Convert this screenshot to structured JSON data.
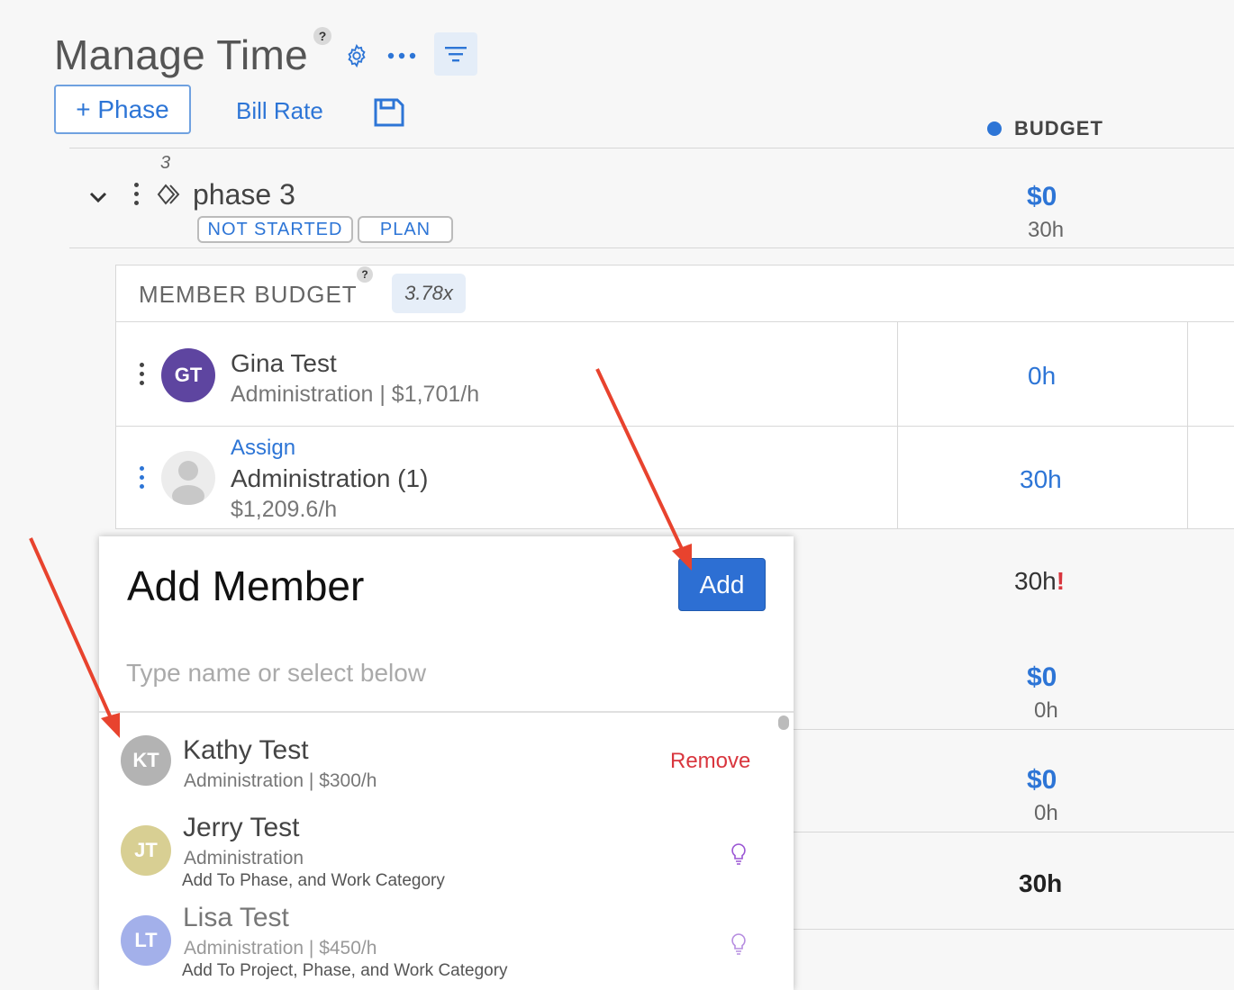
{
  "header": {
    "title": "Manage Time",
    "help": "?",
    "phase_button": "+ Phase",
    "bill_rate": "Bill Rate",
    "budget_label": "BUDGET"
  },
  "phase": {
    "number": "3",
    "name": "phase 3",
    "status": "NOT STARTED",
    "type": "PLAN",
    "budget_amount": "$0",
    "budget_hours": "30h"
  },
  "member_budget": {
    "title": "MEMBER BUDGET",
    "help": "?",
    "multiplier": "3.78x",
    "rows": [
      {
        "initials": "GT",
        "name": "Gina Test",
        "role": "Administration",
        "rate": "$1,701/h",
        "hours": "0h"
      },
      {
        "assign_label": "Assign",
        "name": "Administration (1)",
        "rate": "$1,209.6/h",
        "hours": "30h"
      }
    ]
  },
  "right_column": {
    "total_hours": "30h",
    "total_warning": "!",
    "row1_amount": "$0",
    "row1_hours": "0h",
    "row2_amount": "$0",
    "row2_hours": "0h",
    "bottom_total": "30h"
  },
  "add_member": {
    "title": "Add Member",
    "add_button": "Add",
    "search_placeholder": "Type name or select below",
    "members": [
      {
        "initials": "KT",
        "name": "Kathy Test",
        "role": "Administration",
        "rate": "$300/h",
        "action": "Remove",
        "avatar_color": "#b3b3b3"
      },
      {
        "initials": "JT",
        "name": "Jerry Test",
        "role": "Administration",
        "hint": "Add To Phase, and Work Category",
        "avatar_color": "#d8cf93"
      },
      {
        "initials": "LT",
        "name": "Lisa Test",
        "role": "Administration",
        "rate": "$450/h",
        "hint": "Add To Project, Phase, and Work Category",
        "avatar_color": "#a3b0ea"
      }
    ]
  },
  "colors": {
    "accent": "#2d75d6",
    "danger": "#d9363e",
    "avatar_gina": "#5e45a0",
    "annotation_arrow": "#e8432e"
  }
}
